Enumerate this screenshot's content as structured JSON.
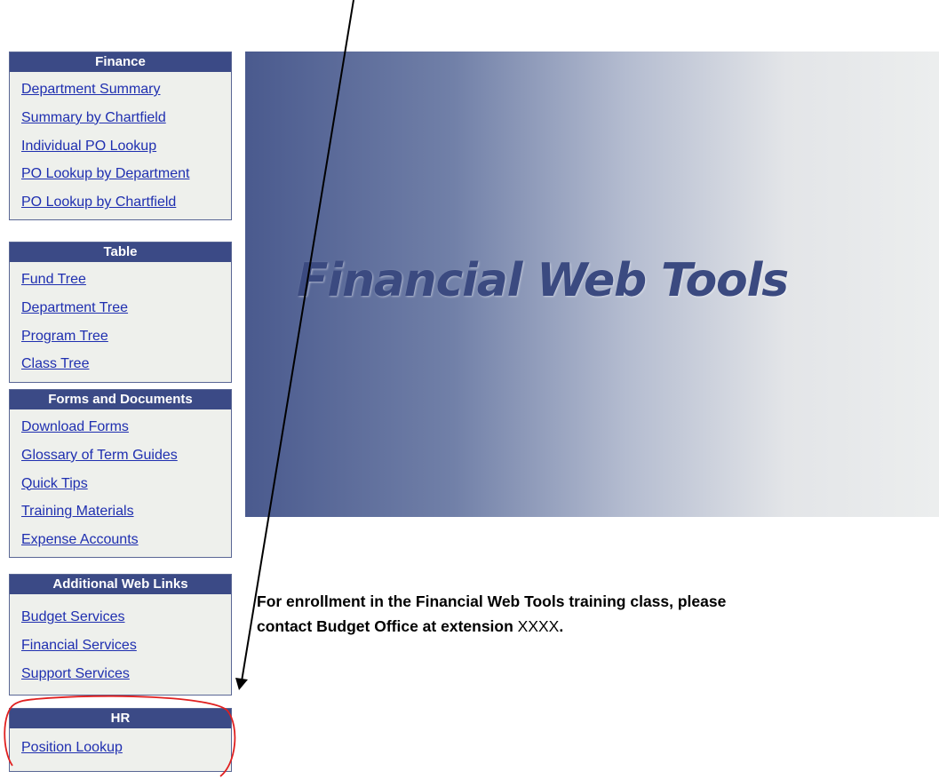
{
  "sidebar": {
    "finance": {
      "header": "Finance",
      "links": [
        "Department Summary",
        "Summary by Chartfield",
        "Individual PO Lookup",
        "PO Lookup by Department",
        "PO Lookup by Chartfield"
      ]
    },
    "table": {
      "header": "Table",
      "links": [
        "Fund Tree",
        "Department Tree",
        "Program Tree",
        "Class Tree"
      ]
    },
    "forms": {
      "header": "Forms and Documents",
      "links": [
        "Download Forms",
        "Glossary of Term Guides",
        "Quick Tips",
        "Training Materials",
        "Expense Accounts"
      ]
    },
    "web_links": {
      "header": "Additional Web Links",
      "links": [
        "Budget Services",
        "Financial Services",
        "Support Services"
      ]
    },
    "hr": {
      "header": "HR",
      "links": [
        "Position Lookup"
      ]
    }
  },
  "banner": {
    "title": "Financial Web Tools"
  },
  "notice": {
    "line1": "For enrollment in the Financial Web Tools training class, please",
    "line2_prefix": "contact Budget Office at extension ",
    "extension": "XXXX",
    "line2_suffix": "."
  },
  "colors": {
    "panel_header": "#3b4a86",
    "panel_bg": "#eef0ec",
    "link": "#1f2fb0",
    "highlight_circle": "#e02020",
    "arrow": "#000000"
  }
}
